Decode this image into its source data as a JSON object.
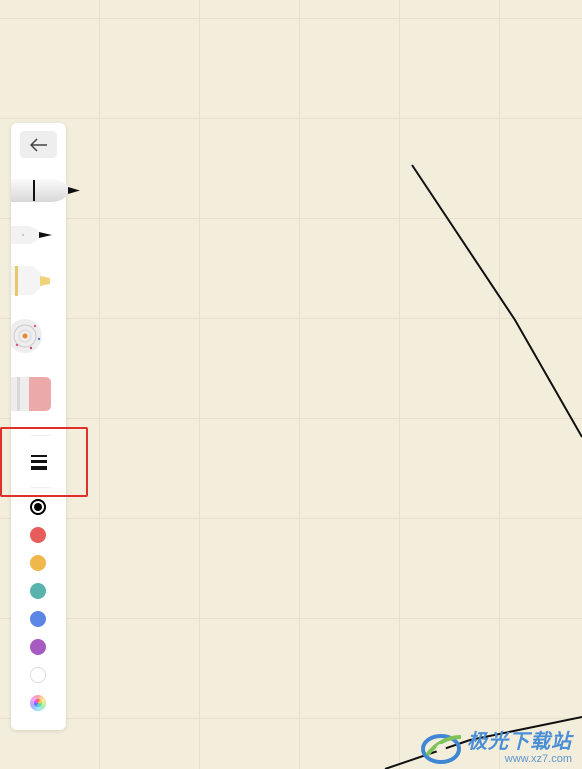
{
  "toolbar": {
    "back_icon": "arrow-left-icon",
    "tools": [
      {
        "name": "fountain-pen",
        "icon": "fountain-pen-icon"
      },
      {
        "name": "ballpoint-pen",
        "icon": "ballpoint-pen-icon"
      },
      {
        "name": "highlighter",
        "icon": "highlighter-icon"
      },
      {
        "name": "laser-pointer",
        "icon": "laser-pointer-icon"
      },
      {
        "name": "eraser",
        "icon": "eraser-icon"
      }
    ],
    "stroke_width_icon": "line-width-icon",
    "colors": [
      {
        "name": "black",
        "hex": "#000000",
        "selected": true
      },
      {
        "name": "red",
        "hex": "#e65d5b"
      },
      {
        "name": "yellow",
        "hex": "#f0b84b"
      },
      {
        "name": "teal",
        "hex": "#58b3ad"
      },
      {
        "name": "blue",
        "hex": "#5b86e5"
      },
      {
        "name": "purple",
        "hex": "#a85ac3"
      },
      {
        "name": "white",
        "hex": "#ffffff"
      },
      {
        "name": "custom",
        "icon": "color-wheel-icon"
      }
    ]
  },
  "highlight_color": "#e0302a",
  "canvas_color": "#f3eedc",
  "watermark": {
    "text": "极光下载站",
    "url": "www.xz7.com"
  }
}
